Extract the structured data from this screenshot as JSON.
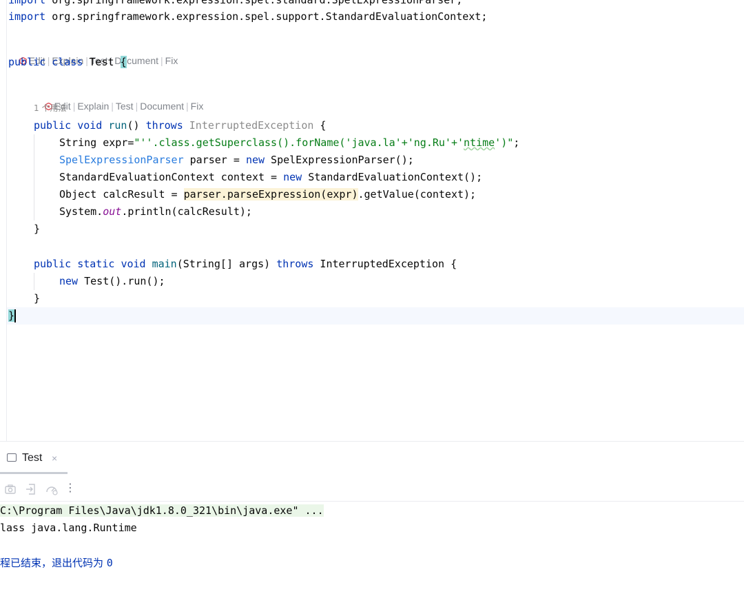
{
  "editor": {
    "code": {
      "import1": {
        "kw": "import",
        "path": " org.springframework.expression.spel.standard.SpelExpressionParser;"
      },
      "import2": {
        "kw": "import",
        "path": " org.springframework.expression.spel.support.StandardEvaluationContext;"
      },
      "class_decl": {
        "public": "public",
        "class": "class",
        "name": " Test ",
        "brace": "{"
      },
      "run_decl": {
        "public": "public",
        "void": "void",
        "name": "run",
        "parens": "() ",
        "throws": "throws",
        "exc": " InterruptedException",
        "brace": " {"
      },
      "line_expr": {
        "pre": "String expr=",
        "s1": "\"''.class.getSuperclass().forName('java.la'+'ng.Ru'+'",
        "s2": "ntime",
        "s3": "')\"",
        "end": ";"
      },
      "line_parser": {
        "type": "SpelExpressionParser",
        "mid": " parser = ",
        "new": "new",
        "rest": " SpelExpressionParser();"
      },
      "line_context": {
        "pre": "StandardEvaluationContext context = ",
        "new": "new",
        "rest": " StandardEvaluationContext();"
      },
      "line_calc": {
        "pre": "Object calcResult = ",
        "hl": "parser.parseExpression(expr)",
        "rest": ".getValue(context);"
      },
      "line_print": {
        "pre": "System.",
        "out": "out",
        "rest": ".println(calcResult);"
      },
      "close_run": "}",
      "main_decl": {
        "public": "public",
        "static": "static",
        "void": "void",
        "name": "main",
        "params": "(String[] args) ",
        "throws": "throws",
        "exc": " InterruptedException {"
      },
      "line_new": {
        "new": "new",
        "rest": " Test().run();"
      },
      "close_main": "}",
      "close_class": "}"
    },
    "ai_hints": {
      "edit": "Edit",
      "explain": "Explain",
      "test": "Test",
      "document": "Document",
      "fix": "Fix",
      "separator": "|"
    },
    "usage_hint": "1 个用法"
  },
  "run_panel": {
    "tab_label": "Test",
    "tab_close": "×",
    "toolbar_icons": [
      "camera-icon",
      "export-icon",
      "gauge-icon",
      "more-options-icon"
    ],
    "more_glyph": "⋮",
    "console": {
      "command": "C:\\Program Files\\Java\\jdk1.8.0_321\\bin\\java.exe\" ...",
      "output": "lass java.lang.Runtime",
      "exit_text": "程已结束，退出代码为 ",
      "exit_code": "0"
    }
  },
  "colors": {
    "keyword": "#0033b3",
    "string": "#067d17",
    "static_field": "#871094",
    "method": "#00627a",
    "ai_icon": "#e0555e"
  }
}
